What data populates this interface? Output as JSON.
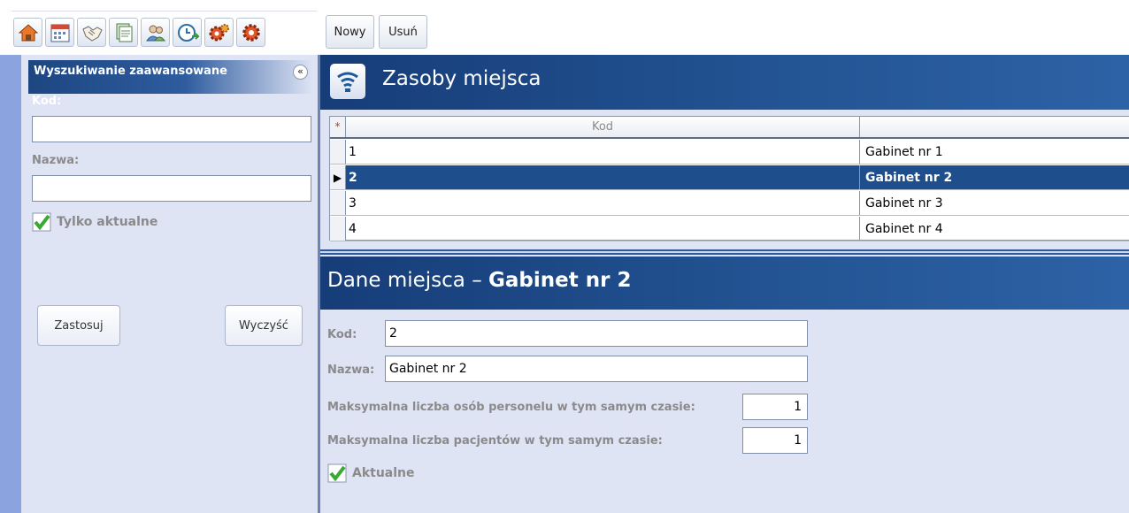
{
  "toolbar": {
    "icons": [
      "home-icon",
      "calendar-icon",
      "handshake-icon",
      "documents-icon",
      "users-icon",
      "clock-arrow-icon",
      "gears-icon",
      "gear-icon"
    ],
    "new_label": "Nowy",
    "delete_label": "Usuń"
  },
  "search": {
    "title": "Wyszukiwanie zaawansowane",
    "code_label": "Kod:",
    "code_value": "",
    "name_label": "Nazwa:",
    "name_value": "",
    "only_current_label": "Tylko aktualne",
    "only_current_checked": true,
    "apply_label": "Zastosuj",
    "clear_label": "Wyczyść"
  },
  "resources": {
    "title": "Zasoby miejsca",
    "columns": [
      "Kod",
      ""
    ],
    "new_row_marker": "*",
    "selected_marker": "▶",
    "rows": [
      {
        "kod": "1",
        "name": "Gabinet nr 1"
      },
      {
        "kod": "2",
        "name": "Gabinet nr 2"
      },
      {
        "kod": "3",
        "name": "Gabinet nr 3"
      },
      {
        "kod": "4",
        "name": "Gabinet nr 4"
      }
    ],
    "selected_index": 1
  },
  "detail": {
    "title_prefix": "Dane miejsca – ",
    "title_name": "Gabinet nr 2",
    "code_label": "Kod:",
    "code_value": "2",
    "name_label": "Nazwa:",
    "name_value": "Gabinet nr 2",
    "max_staff_label": "Maksymalna liczba osób personelu w tym samym czasie:",
    "max_staff_value": "1",
    "max_patients_label": "Maksymalna liczba pacjentów w tym samym czasie:",
    "max_patients_value": "1",
    "active_label": "Aktualne",
    "active_checked": true
  },
  "colors": {
    "header_blue": "#1e4e8c",
    "panel_bg": "#dfe4f5",
    "accent_strip": "#8ba4e0",
    "check_green": "#3aa832"
  }
}
